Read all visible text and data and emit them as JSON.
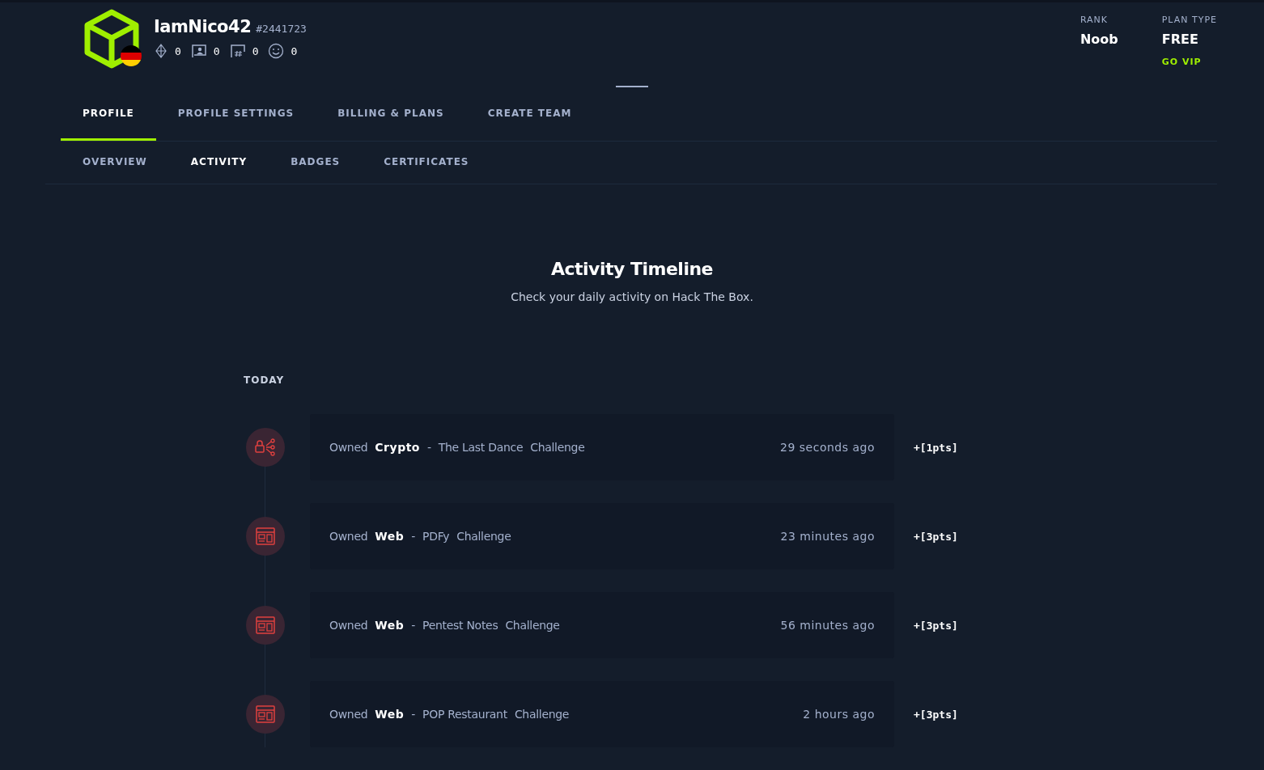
{
  "profile": {
    "username": "IamNico42",
    "user_id": "#2441723",
    "stats": [
      {
        "kind": "points",
        "value": "0"
      },
      {
        "kind": "user-owns",
        "value": "0"
      },
      {
        "kind": "system-owns",
        "value": "0"
      },
      {
        "kind": "respect",
        "value": "0"
      }
    ]
  },
  "rank": {
    "label": "RANK",
    "value": "Noob"
  },
  "plan": {
    "label": "PLAN TYPE",
    "value": "FREE",
    "action": "GO VIP"
  },
  "main_tabs": [
    {
      "label": "PROFILE",
      "selected": true
    },
    {
      "label": "PROFILE SETTINGS",
      "selected": false
    },
    {
      "label": "BILLING & PLANS",
      "selected": false
    },
    {
      "label": "CREATE TEAM",
      "selected": false
    }
  ],
  "sub_tabs": [
    {
      "label": "OVERVIEW",
      "selected": false
    },
    {
      "label": "ACTIVITY",
      "selected": true
    },
    {
      "label": "BADGES",
      "selected": false
    },
    {
      "label": "CERTIFICATES",
      "selected": false
    }
  ],
  "timeline": {
    "title": "Activity Timeline",
    "subtitle": "Check your daily activity on Hack The Box.",
    "group": "TODAY",
    "entries": [
      {
        "kind": "crypto",
        "verb": "Owned",
        "category": "Crypto",
        "separator": "-",
        "name": "The Last Dance",
        "type": "Challenge",
        "time": "29 seconds ago",
        "points": "+[1pts]"
      },
      {
        "kind": "web",
        "verb": "Owned",
        "category": "Web",
        "separator": "-",
        "name": "PDFy",
        "type": "Challenge",
        "time": "23 minutes ago",
        "points": "+[3pts]"
      },
      {
        "kind": "web",
        "verb": "Owned",
        "category": "Web",
        "separator": "-",
        "name": "Pentest Notes",
        "type": "Challenge",
        "time": "56 minutes ago",
        "points": "+[3pts]"
      },
      {
        "kind": "web",
        "verb": "Owned",
        "category": "Web",
        "separator": "-",
        "name": "POP Restaurant",
        "type": "Challenge",
        "time": "2 hours ago",
        "points": "+[3pts]"
      }
    ]
  }
}
